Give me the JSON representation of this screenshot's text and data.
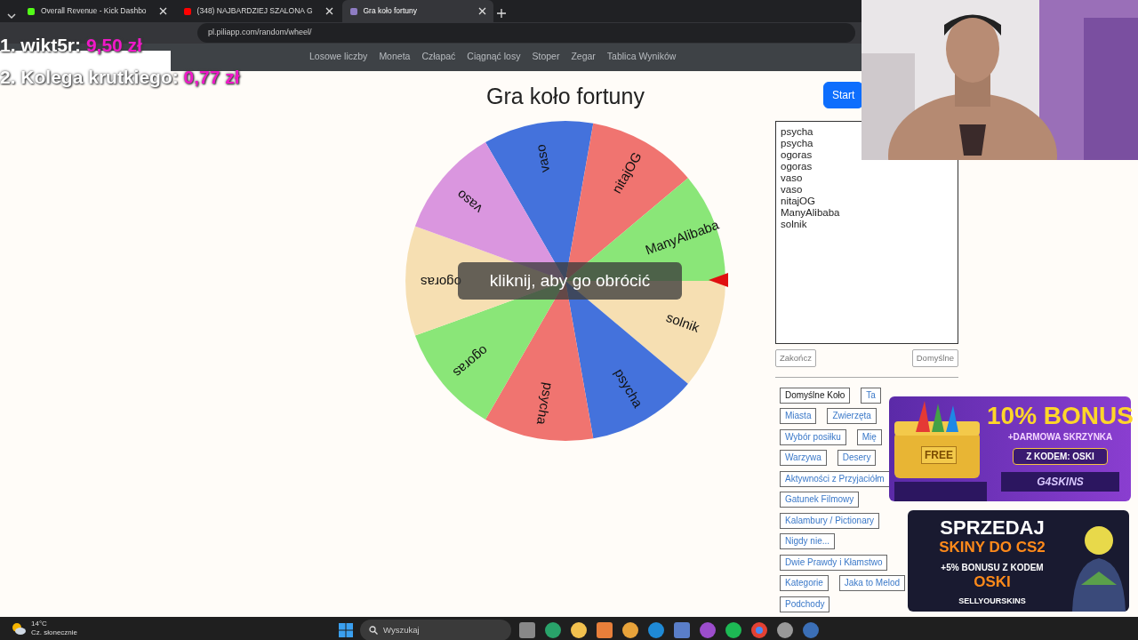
{
  "browser": {
    "tabs": [
      {
        "title": "Overall Revenue - Kick Dashbo",
        "selected": false,
        "color": "#53fc18"
      },
      {
        "title": "(348) NAJBARDZIEJ SZALONA G",
        "selected": false,
        "color": "#ff0000"
      },
      {
        "title": "Gra koło fortuny",
        "selected": true,
        "color": "#8e7cc3"
      }
    ],
    "url": "pl.piliapp.com/random/wheel/"
  },
  "site_nav": [
    "Losowe liczby",
    "Moneta",
    "Człapać",
    "Ciągnąć losy",
    "Stoper",
    "Zegar",
    "Tablica Wyników"
  ],
  "stream_overlay": {
    "ranking": [
      {
        "place": "1.",
        "name": "wikt5r:",
        "amount": "9,50 zł"
      },
      {
        "place": "2.",
        "name": "Kolega krutkiego:",
        "amount": "0,77 zł"
      }
    ]
  },
  "title": "Gra koło fortuny",
  "start_button": "Start",
  "wheel": {
    "hint": "kliknij, aby go obrócić",
    "segments": [
      {
        "label": "vaso",
        "color": "#4472dc"
      },
      {
        "label": "nitajOG",
        "color": "#f07470"
      },
      {
        "label": "ManyAlibaba",
        "color": "#8ae678"
      },
      {
        "label": "solnik",
        "color": "#f6dfb2"
      },
      {
        "label": "psycha",
        "color": "#4472dc"
      },
      {
        "label": "psycha",
        "color": "#f07470"
      },
      {
        "label": "ogoras",
        "color": "#8ae678"
      },
      {
        "label": "ogoras",
        "color": "#f6dfb2"
      },
      {
        "label": "vaso",
        "color": "#da96df"
      }
    ]
  },
  "entries": [
    "psycha",
    "psycha",
    "ogoras",
    "ogoras",
    "vaso",
    "vaso",
    "nitajOG",
    "ManyAlibaba",
    "solnik"
  ],
  "entry_buttons": [
    "Zakończ",
    "Domyślne"
  ],
  "preset_rows": [
    [
      {
        "label": "Domyślne Koło",
        "selected": true
      },
      {
        "label": "Ta",
        "selected": false
      }
    ],
    [
      {
        "label": "Miasta",
        "selected": false
      },
      {
        "label": "Zwierzęta",
        "selected": false
      }
    ],
    [
      {
        "label": "Wybór posiłku",
        "selected": false
      },
      {
        "label": "Mię",
        "selected": false
      }
    ],
    [
      {
        "label": "Warzywa",
        "selected": false
      },
      {
        "label": "Desery",
        "selected": false
      }
    ],
    [
      {
        "label": "Aktywności z Przyjaciółm",
        "selected": false
      }
    ],
    [
      {
        "label": "Gatunek Filmowy",
        "selected": false
      }
    ],
    [
      {
        "label": "Kalambury / Pictionary",
        "selected": false
      }
    ],
    [
      {
        "label": "Nigdy nie...",
        "selected": false
      }
    ],
    [
      {
        "label": "Dwie Prawdy i Kłamstwo",
        "selected": false
      }
    ],
    [
      {
        "label": "Kategorie",
        "selected": false
      },
      {
        "label": "Jaka to Melod",
        "selected": false
      }
    ],
    [
      {
        "label": "Podchody",
        "selected": false
      }
    ]
  ],
  "ads": [
    {
      "kind": "bonus",
      "headline": "10% BONUS",
      "subline": "+DARMOWA SKRZYNKA",
      "code": "Z KODEM: OSKI",
      "brand": "G4SKINS",
      "badge": "FREE"
    },
    {
      "kind": "sell",
      "headline": "SPRZEDAJ",
      "subline": "SKINY DO CS2",
      "code": "+5% BONUSU Z KODEM",
      "brand_code": "OSKI",
      "brand": "SELLYOURSKINS"
    }
  ],
  "taskbar": {
    "temperature": "14°C",
    "weather": "Cz. słonecznie",
    "search_placeholder": "Wyszukaj"
  }
}
